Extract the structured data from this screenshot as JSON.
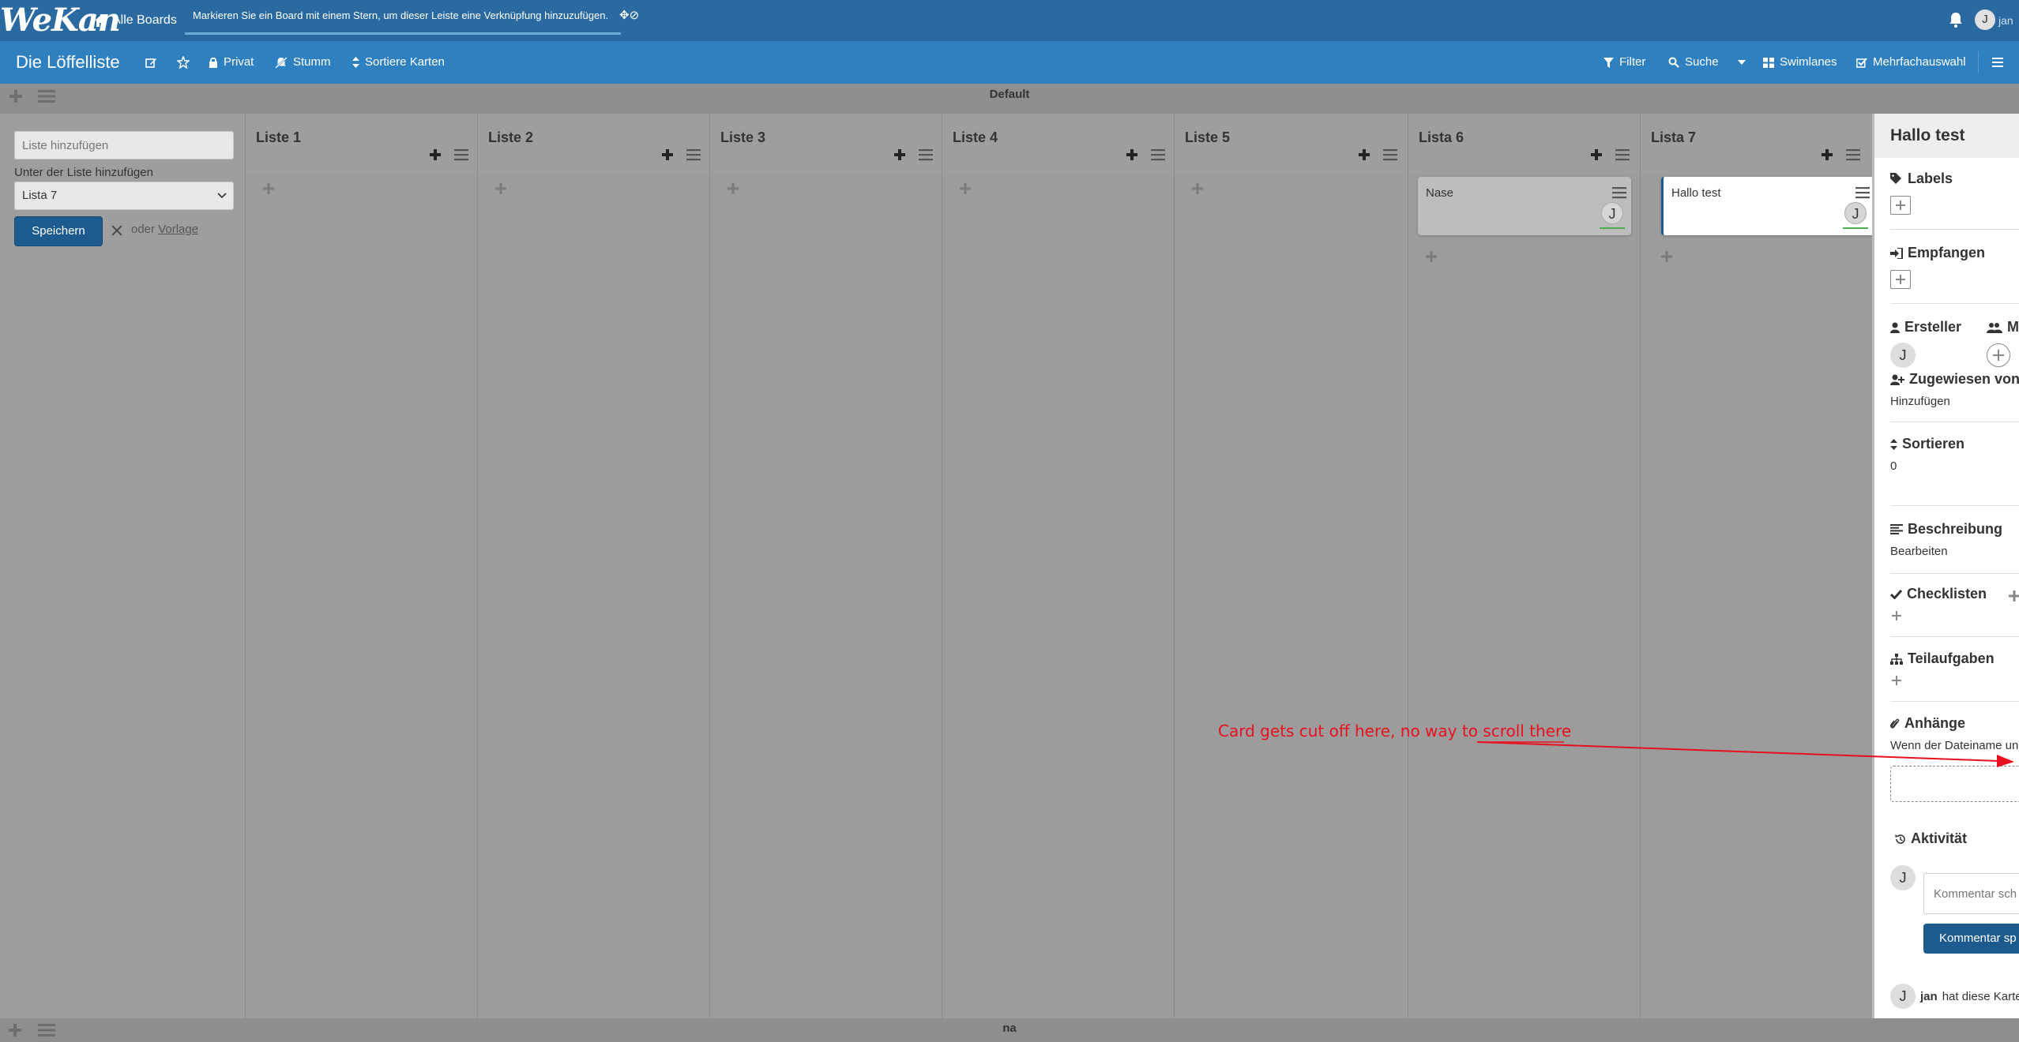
{
  "header": {
    "logo_text": "WeKan",
    "all_boards_label": "Alle Boards",
    "announcement": "Markieren Sie ein Board mit einem Stern, um dieser Leiste eine Verknüpfung hinzuzufügen.",
    "user_initial": "J",
    "user_name": "jan"
  },
  "board": {
    "title": "Die Löffelliste",
    "visibility_label": "Privat",
    "mute_label": "Stumm",
    "sort_label": "Sortiere Karten",
    "filter_label": "Filter",
    "search_label": "Suche",
    "view_label": "Swimlanes",
    "multiselect_label": "Mehrfachauswahl"
  },
  "swimlane": {
    "title": "Default",
    "bottom_title": "na"
  },
  "add_list": {
    "placeholder": "Liste hinzufügen",
    "position_label": "Unter der Liste hinzufügen",
    "selected_list": "Lista 7",
    "save_label": "Speichern",
    "or_label": "oder",
    "template_label": "Vorlage"
  },
  "lists": [
    {
      "title": "Liste 1",
      "cards": []
    },
    {
      "title": "Liste 2",
      "cards": []
    },
    {
      "title": "Liste 3",
      "cards": []
    },
    {
      "title": "Liste 4",
      "cards": []
    },
    {
      "title": "Liste 5",
      "cards": []
    },
    {
      "title": "Lista 6",
      "cards": [
        {
          "title": "Nase",
          "member_initial": "J"
        }
      ]
    },
    {
      "title": "Lista 7",
      "cards": [
        {
          "title": "Hallo test",
          "member_initial": "J"
        }
      ]
    }
  ],
  "card_detail": {
    "title": "Hallo test",
    "labels_title": "Labels",
    "received_title": "Empfangen",
    "creator_title": "Ersteller",
    "creator_initial": "J",
    "members_title": "M",
    "assigned_by_title": "Zugewiesen von",
    "assigned_by_action": "Hinzufügen",
    "sort_title": "Sortieren",
    "sort_value": "0",
    "description_title": "Beschreibung",
    "description_action": "Bearbeiten",
    "checklists_title": "Checklisten",
    "subtasks_title": "Teilaufgaben",
    "attachments_title": "Anhänge",
    "attachments_hint": "Wenn der Dateiname un",
    "activity_title": "Aktivität",
    "comment_placeholder": "Kommentar sch",
    "comment_button": "Kommentar sp",
    "activity_user_initial": "J",
    "activity_user": "jan",
    "activity_text": "hat diese Karte"
  },
  "annotation": {
    "text": "Card gets cut off here, no way to scroll there",
    "color": "#e8101e"
  },
  "colors": {
    "top_header": "#2a6aa0",
    "board_header": "#2e80c1",
    "primary_button": "#1d5b8e",
    "background": "#9e9e9e"
  }
}
